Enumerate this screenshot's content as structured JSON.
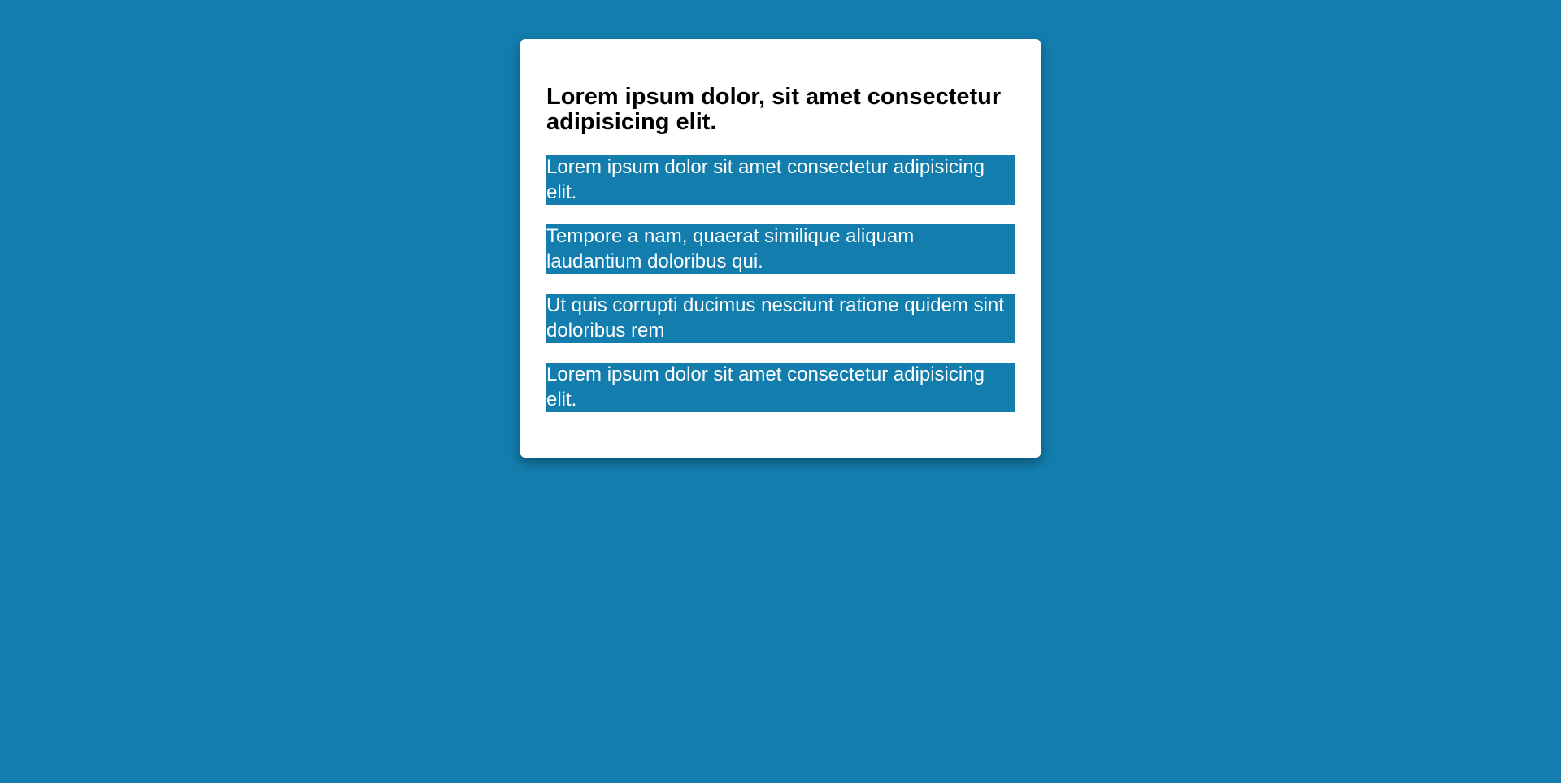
{
  "colors": {
    "background": "#137dad",
    "card": "#ffffff",
    "item_background": "#137dad",
    "item_text": "#ffffff",
    "title_text": "#000000"
  },
  "card": {
    "title": "Lorem ipsum dolor, sit amet consectetur adipisicing elit.",
    "items": [
      "Lorem ipsum dolor sit amet consectetur adipisicing elit.",
      "Tempore a nam, quaerat similique aliquam laudantium doloribus qui.",
      "Ut quis corrupti ducimus nesciunt ratione quidem sint doloribus rem",
      "Lorem ipsum dolor sit amet consectetur adipisicing elit."
    ]
  }
}
